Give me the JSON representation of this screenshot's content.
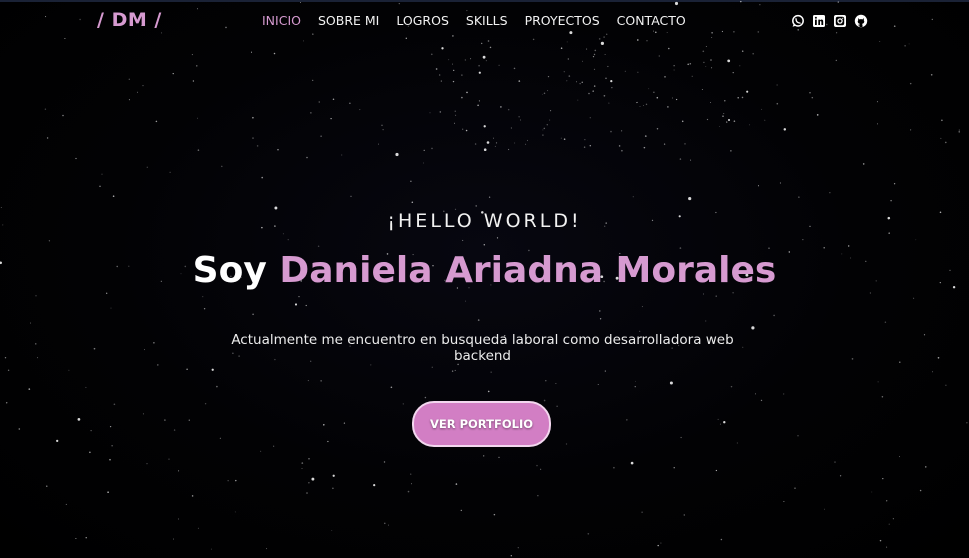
{
  "header": {
    "logo": {
      "slash_left": "/",
      "initials": "DM",
      "slash_right": "/"
    },
    "nav": [
      {
        "label": "INICIO",
        "active": true
      },
      {
        "label": "SOBRE MI",
        "active": false
      },
      {
        "label": "LOGROS",
        "active": false
      },
      {
        "label": "SKILLS",
        "active": false
      },
      {
        "label": "PROYECTOS",
        "active": false
      },
      {
        "label": "CONTACTO",
        "active": false
      }
    ],
    "socials": [
      "whatsapp-icon",
      "linkedin-icon",
      "instagram-icon",
      "github-icon"
    ]
  },
  "hero": {
    "kicker": "¡HELLO WORLD!",
    "title_prefix": "Soy",
    "title_name": "Daniela Ariadna Morales",
    "description": "Actualmente me encuentro en busqueda laboral como desarrolladora web backend",
    "cta_label": "VER PORTFOLIO"
  },
  "colors": {
    "accent": "#d69ad0",
    "button": "#d27ec4",
    "background": "#000000",
    "text": "#ffffff"
  }
}
